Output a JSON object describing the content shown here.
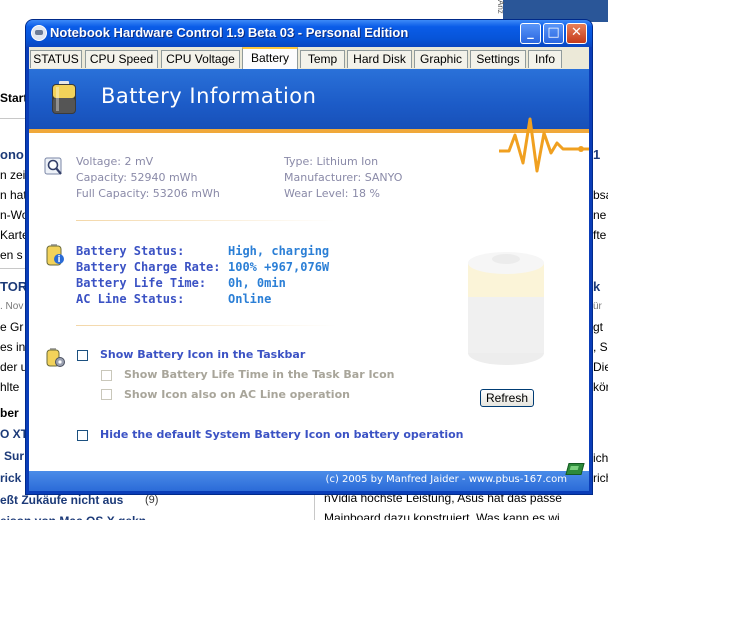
{
  "window": {
    "title": "Notebook Hardware Control 1.9 Beta 03  -  Personal Edition",
    "buttons": {
      "minimize": "_",
      "maximize": "□",
      "close": "✕"
    }
  },
  "tabs": [
    {
      "label": "STATUS",
      "active": false
    },
    {
      "label": "CPU Speed",
      "active": false
    },
    {
      "label": "CPU Voltage",
      "active": false
    },
    {
      "label": "Battery",
      "active": true
    },
    {
      "label": "Temp",
      "active": false
    },
    {
      "label": "Hard Disk",
      "active": false
    },
    {
      "label": "Graphic",
      "active": false
    },
    {
      "label": "Settings",
      "active": false
    },
    {
      "label": "Info",
      "active": false
    }
  ],
  "banner": {
    "title": "Battery Information",
    "icon": "battery-icon"
  },
  "info": {
    "voltage": "Voltage:  2 mV",
    "capacity": "Capacity:  52940 mWh",
    "full_capacity": "Full Capacity:  53206 mWh",
    "type": "Type:  Lithium Ion",
    "manufacturer": "Manufacturer:  SANYO",
    "wear_level": "Wear Level:  18 %"
  },
  "status": {
    "battery_status_label": "Battery Status:",
    "battery_status_value": "High, charging",
    "charge_rate_label": "Battery Charge Rate:",
    "charge_rate_value": "100%  +967,076W",
    "life_time_label": "Battery Life Time:",
    "life_time_value": "0h, 0min",
    "ac_line_label": "AC Line Status:",
    "ac_line_value": "Online"
  },
  "options": {
    "show_taskbar_icon": "Show Battery Icon in the Taskbar",
    "show_life_time": "Show Battery Life Time in the Task Bar Icon",
    "show_on_ac": "Show Icon also on AC Line operation",
    "hide_default": "Hide the default System Battery Icon on battery operation",
    "refresh": "Refresh"
  },
  "footer": {
    "text": "(c) 2005 by Manfred Jaider  -  www.pbus-167.com"
  },
  "background_page": {
    "lines": [
      "Start",
      "ono",
      "n zei",
      "n hat",
      "n-Wo",
      "Karte",
      "en s",
      "TOR",
      ". Nov",
      "e Gr",
      "es in",
      "der u",
      "hlte",
      "ber",
      "O XT",
      "Sur",
      "rick",
      "eßt Zukäufe nicht aus",
      "(9)",
      "1",
      "bsa",
      "ne",
      "fte",
      "k",
      "ür",
      "gt",
      ", S",
      "Die",
      "kör",
      "ich",
      "rich",
      "nVidia höchste Leistung, Asus hat das passe",
      "Mainboard dazu konstruiert. Was kann es wi"
    ],
    "side_text": "Anz"
  }
}
